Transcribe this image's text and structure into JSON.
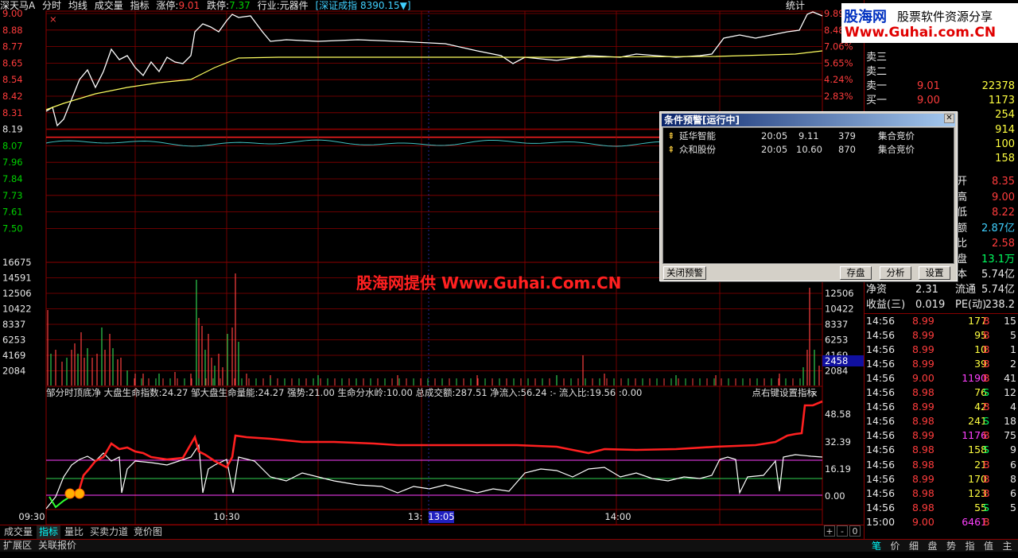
{
  "topbar": {
    "stock_name": "深天马A",
    "menu": [
      "分时",
      "均线",
      "成交量",
      "指标"
    ],
    "limit_up_label": "涨停:",
    "limit_up_value": "9.01",
    "limit_down_label": "跌停:",
    "limit_down_value": "7.37",
    "industry": "行业:元器件",
    "index_info": "[深证成指 8390.15▼]",
    "stats_label": "统计"
  },
  "price_axis_left": [
    "9.00",
    "8.88",
    "8.77",
    "8.65",
    "8.54",
    "8.42",
    "8.31",
    "8.19",
    "8.07",
    "7.96",
    "7.84",
    "7.73",
    "7.61",
    "7.50"
  ],
  "price_axis_right": [
    "9.89%",
    "8.48%",
    "7.06%",
    "5.65%",
    "4.24%",
    "2.83%"
  ],
  "volume_axis": [
    "16675",
    "14591",
    "12506",
    "10422",
    "8337",
    "6253",
    "4169",
    "2084"
  ],
  "volume_highlight": "2458",
  "indicator_axis": [
    "48.58",
    "32.39",
    "16.19",
    "0.00"
  ],
  "time_axis": [
    "09:30",
    "10:30",
    "13:",
    "14:00"
  ],
  "time_cursor": "13:05",
  "indicator_header": {
    "name": "邹分时顶底净",
    "v1": "大盘生命指数:24.27",
    "v2": "邹大盘生命量能:24.27",
    "v3": "强势:21.00",
    "v4": "生命分水岭:10.00",
    "v5": "总成交额:287.51",
    "v6": "净流入:56.24",
    "v7": ":-",
    "v8": "流入比:19.56",
    "v9": ":0.00",
    "hint": "点右键设置指标"
  },
  "watermark_center": "股海网提供 Www.Guhai.Com.CN",
  "logo": {
    "name": "股海网",
    "tagline": "股票软件资源分享",
    "url": "Www.Guhai.com.CN"
  },
  "order_book": [
    {
      "label": "卖三",
      "price": "",
      "vol": ""
    },
    {
      "label": "卖二",
      "price": "",
      "vol": ""
    },
    {
      "label": "卖一",
      "price": "9.01",
      "vol": "22378"
    },
    {
      "label": "买一",
      "price": "9.00",
      "vol": "1173"
    },
    {
      "label": "",
      "price": "",
      "vol": "254"
    },
    {
      "label": "",
      "price": "",
      "vol": "914"
    },
    {
      "label": "",
      "price": "",
      "vol": "100"
    },
    {
      "label": "",
      "price": "",
      "vol": "158"
    }
  ],
  "quote_info": [
    {
      "label": "开",
      "value": "8.35"
    },
    {
      "label": "高",
      "value": "9.00"
    },
    {
      "label": "低",
      "value": "8.22"
    },
    {
      "label": "额",
      "value": "2.87亿"
    },
    {
      "label": "比",
      "value": "2.58"
    },
    {
      "label": "盘",
      "value": "13.1万"
    },
    {
      "label": "本",
      "value": "5.74亿"
    }
  ],
  "fundamentals": [
    {
      "l1": "净资",
      "v1": "2.31",
      "l2": "流通",
      "v2": "5.74亿"
    },
    {
      "l1": "收益(三)",
      "v1": "0.019",
      "l2": "PE(动)",
      "v2": "238.2"
    }
  ],
  "ticks": [
    {
      "time": "14:56",
      "price": "8.99",
      "vol": "177",
      "side": "B",
      "n": "15"
    },
    {
      "time": "14:56",
      "price": "8.99",
      "vol": "95",
      "side": "B",
      "n": "5"
    },
    {
      "time": "14:56",
      "price": "8.99",
      "vol": "10",
      "side": "B",
      "n": "1"
    },
    {
      "time": "14:56",
      "price": "8.99",
      "vol": "39",
      "side": "B",
      "n": "2"
    },
    {
      "time": "14:56",
      "price": "9.00",
      "vol": "1190",
      "side": "B",
      "n": "41"
    },
    {
      "time": "14:56",
      "price": "8.98",
      "vol": "76",
      "side": "S",
      "n": "12"
    },
    {
      "time": "14:56",
      "price": "8.99",
      "vol": "42",
      "side": "B",
      "n": "4"
    },
    {
      "time": "14:56",
      "price": "8.98",
      "vol": "241",
      "side": "S",
      "n": "18"
    },
    {
      "time": "14:56",
      "price": "8.99",
      "vol": "1176",
      "side": "B",
      "n": "75"
    },
    {
      "time": "14:56",
      "price": "8.98",
      "vol": "158",
      "side": "S",
      "n": "9"
    },
    {
      "time": "14:56",
      "price": "8.98",
      "vol": "21",
      "side": "B",
      "n": "6"
    },
    {
      "time": "14:56",
      "price": "8.99",
      "vol": "170",
      "side": "B",
      "n": "8"
    },
    {
      "time": "14:56",
      "price": "8.98",
      "vol": "123",
      "side": "B",
      "n": "6"
    },
    {
      "time": "14:56",
      "price": "8.98",
      "vol": "55",
      "side": "S",
      "n": "5"
    },
    {
      "time": "15:00",
      "price": "9.00",
      "vol": "6461",
      "side": "B",
      "n": ""
    }
  ],
  "dialog": {
    "title": "条件预警[运行中]",
    "items": [
      {
        "name": "延华智能",
        "time": "20:05",
        "price": "9.11",
        "vol": "379",
        "cond": "集合竞价"
      },
      {
        "name": "众和股份",
        "time": "20:05",
        "price": "10.60",
        "vol": "870",
        "cond": "集合竞价"
      }
    ],
    "btn_close": "关闭预警",
    "btn_save": "存盘",
    "btn_analyze": "分析",
    "btn_settings": "设置"
  },
  "tabs": [
    "成交量",
    "指标",
    "量比",
    "买卖力道",
    "竞价图"
  ],
  "bottom_left": [
    "扩展区",
    "关联报价"
  ],
  "right_tabs": [
    "笔",
    "价",
    "细",
    "盘",
    "势",
    "指",
    "值",
    "主"
  ],
  "scroll_controls": [
    "+",
    "-",
    "0"
  ],
  "colors": {
    "up": "#ff3c3c",
    "down": "#00d000",
    "grid": "#8b0000",
    "price_line": "#ffffff",
    "avg_line": "#ffff60",
    "indicator_red": "#ff2020"
  }
}
